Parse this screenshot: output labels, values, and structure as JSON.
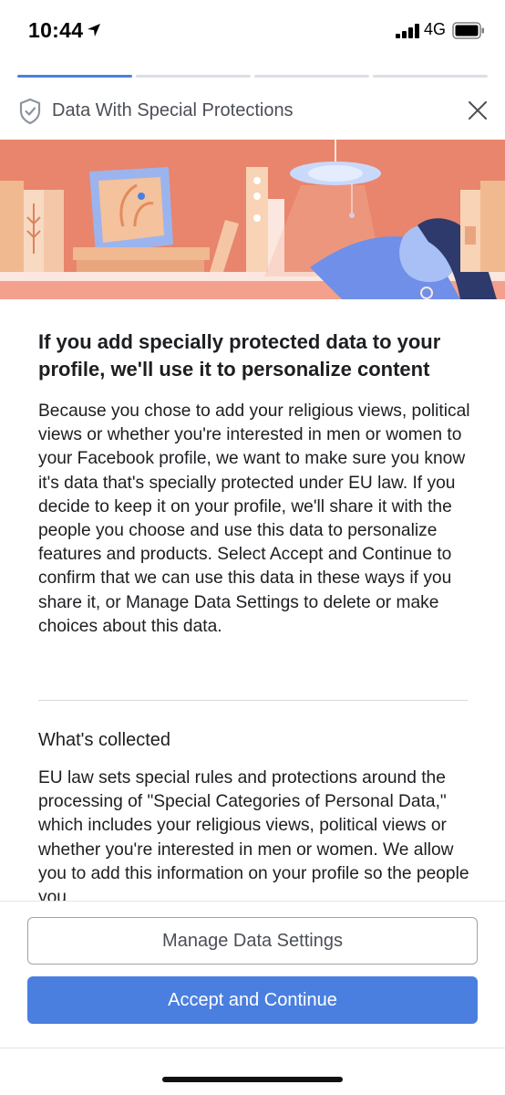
{
  "status_bar": {
    "time": "10:44",
    "network": "4G"
  },
  "progress": {
    "total_steps": 4,
    "current_step": 1
  },
  "header": {
    "title": "Data With Special Protections"
  },
  "main": {
    "headline": "If you add specially protected data to your profile, we'll use it to personalize content",
    "body": "Because you chose to add your religious views, political views or whether you're interested in men or women to your Facebook profile, we want to make sure you know it's data that's specially protected under EU law. If you decide to keep it on your profile, we'll share it with the people you choose and use this data to personalize features and products. Select Accept and Continue to confirm that we can use this data in these ways if you share it, or Manage Data Settings to delete or make choices about this data.",
    "section_title": "What's collected",
    "section_body": "EU law sets special rules and protections around the processing of \"Special Categories of Personal Data,\" which includes your religious views, political views or whether you're interested in men or women. We allow you to add this information on your profile so the people you"
  },
  "buttons": {
    "manage": "Manage Data Settings",
    "accept": "Accept and Continue"
  },
  "colors": {
    "accent": "#4a7fe0",
    "illustration_bg": "#e8856c"
  }
}
